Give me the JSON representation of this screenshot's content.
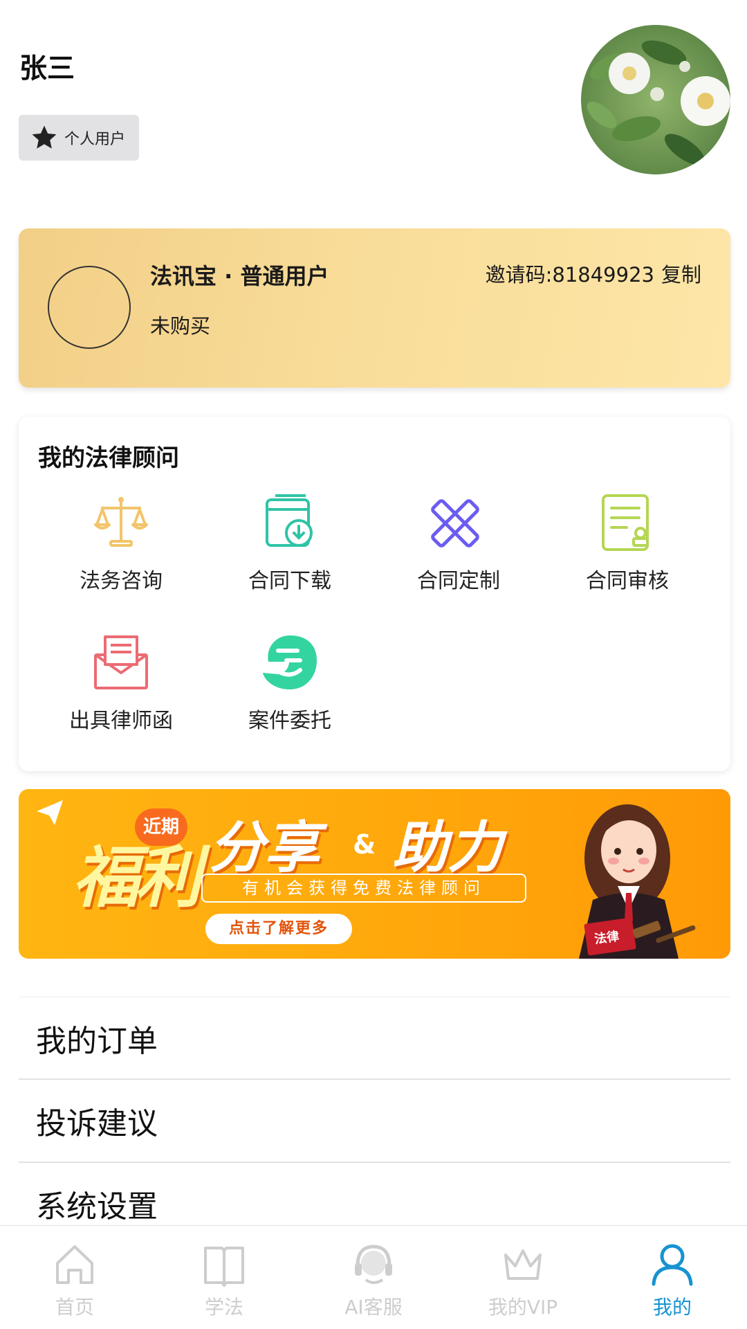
{
  "header": {
    "user_name": "张三",
    "badge_label": "个人用户"
  },
  "membership": {
    "title": "法讯宝 · 普通用户",
    "status": "未购买",
    "invite_label": "邀请码:81849923",
    "copy_label": "复制"
  },
  "advisor": {
    "title": "我的法律顾问",
    "services": [
      {
        "label": "法务咨询",
        "icon": "scales-icon",
        "color": "#f2c56b"
      },
      {
        "label": "合同下载",
        "icon": "contract-download-icon",
        "color": "#2ec4a6"
      },
      {
        "label": "合同定制",
        "icon": "pencil-ruler-icon",
        "color": "#6b5cf2"
      },
      {
        "label": "合同审核",
        "icon": "document-review-icon",
        "color": "#b5d654"
      },
      {
        "label": "出具律师函",
        "icon": "envelope-letter-icon",
        "color": "#ec6b73"
      },
      {
        "label": "案件委托",
        "icon": "hand-e-icon",
        "color": "#33d4a0"
      }
    ]
  },
  "banner": {
    "recent_label": "近期",
    "welfare_text": "福利",
    "share_text": "分享",
    "amp_text": "&",
    "help_text": "助力",
    "subtitle": "有机会获得免费法律顾问",
    "button_label": "点击了解更多",
    "book_text": "法律"
  },
  "menu": {
    "items": [
      "我的订单",
      "投诉建议",
      "系统设置"
    ]
  },
  "nav": {
    "items": [
      {
        "label": "首页",
        "icon": "home-icon"
      },
      {
        "label": "学法",
        "icon": "book-icon"
      },
      {
        "label": "AI客服",
        "icon": "headset-icon"
      },
      {
        "label": "我的VIP",
        "icon": "crown-icon"
      },
      {
        "label": "我的",
        "icon": "user-icon"
      }
    ],
    "active_index": 4,
    "active_color": "#1793d1",
    "inactive_color": "#cdcdcd"
  }
}
